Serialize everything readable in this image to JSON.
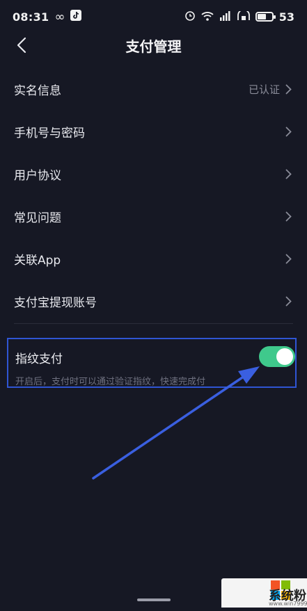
{
  "status_bar": {
    "time": "08:31",
    "battery": "53"
  },
  "nav": {
    "title": "支付管理"
  },
  "menu": [
    {
      "label": "实名信息",
      "value": "已认证"
    },
    {
      "label": "手机号与密码",
      "value": ""
    },
    {
      "label": "用户协议",
      "value": ""
    },
    {
      "label": "常见问题",
      "value": ""
    },
    {
      "label": "关联App",
      "value": ""
    },
    {
      "label": "支付宝提现账号",
      "value": ""
    }
  ],
  "fingerprint": {
    "title": "指纹支付",
    "description": "开启后，支付时可以通过验证指纹，快速完成付",
    "enabled": true
  },
  "watermark": {
    "text": "系统粉",
    "url": "www.win7999.com"
  },
  "colors": {
    "background": "#161824",
    "toggle_on": "#3fc98c",
    "highlight": "#2f55d4"
  }
}
